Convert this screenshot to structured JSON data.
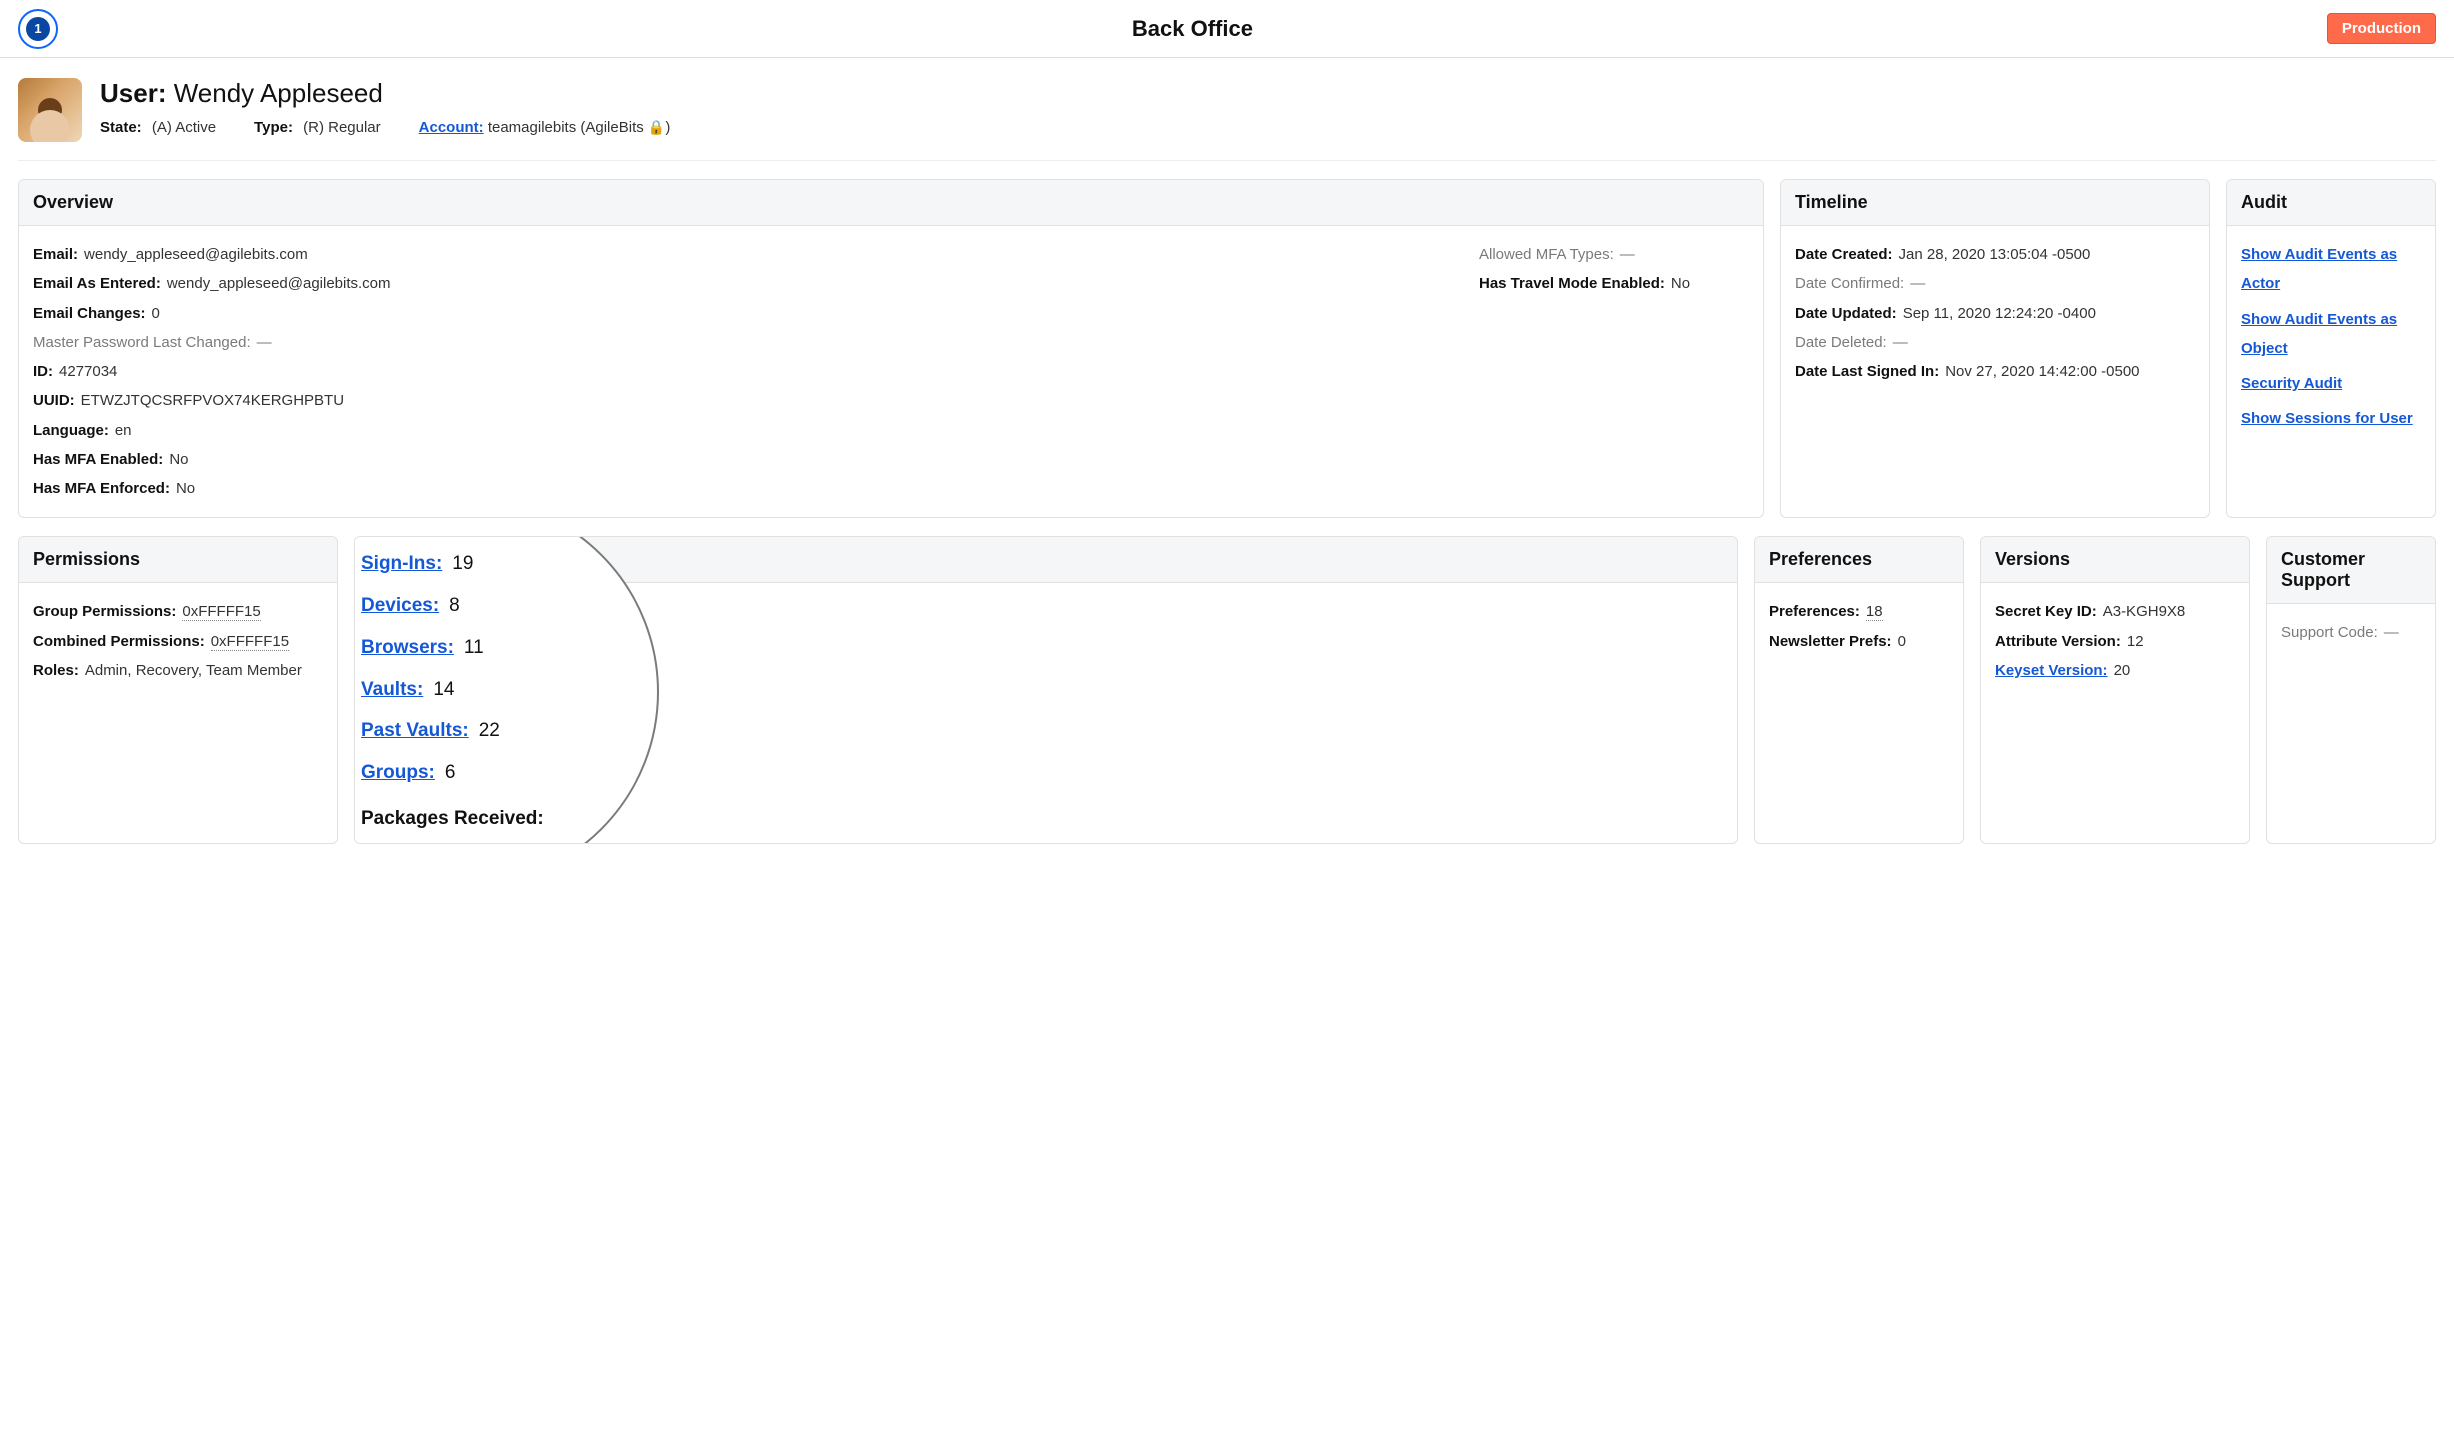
{
  "topbar": {
    "title": "Back Office",
    "env_badge": "Production",
    "logo_text": "1"
  },
  "user_header": {
    "prefix": "User:",
    "name": "Wendy Appleseed",
    "state_label": "State:",
    "state_value": "(A) Active",
    "type_label": "Type:",
    "type_value": "(R) Regular",
    "account_label": "Account:",
    "account_value": "teamagilebits (AgileBits ",
    "account_suffix": ")"
  },
  "overview": {
    "title": "Overview",
    "left": {
      "email_k": "Email:",
      "email_v": "wendy_appleseed@agilebits.com",
      "email_entered_k": "Email As Entered:",
      "email_entered_v": "wendy_appleseed@agilebits.com",
      "email_changes_k": "Email Changes:",
      "email_changes_v": "0",
      "mp_changed_k": "Master Password Last Changed:",
      "mp_changed_v": "—",
      "id_k": "ID:",
      "id_v": "4277034",
      "uuid_k": "UUID:",
      "uuid_v": "ETWZJTQCSRFPVOX74KERGHPBTU",
      "lang_k": "Language:",
      "lang_v": "en",
      "mfa_enabled_k": "Has MFA Enabled:",
      "mfa_enabled_v": "No",
      "mfa_enforced_k": "Has MFA Enforced:",
      "mfa_enforced_v": "No"
    },
    "right": {
      "mfa_types_k": "Allowed MFA Types:",
      "mfa_types_v": "—",
      "travel_k": "Has Travel Mode Enabled:",
      "travel_v": "No"
    }
  },
  "timeline": {
    "title": "Timeline",
    "created_k": "Date Created:",
    "created_v": "Jan 28, 2020 13:05:04 -0500",
    "confirmed_k": "Date Confirmed:",
    "confirmed_v": "—",
    "updated_k": "Date Updated:",
    "updated_v": "Sep 11, 2020 12:24:20 -0400",
    "deleted_k": "Date Deleted:",
    "deleted_v": "—",
    "last_signin_k": "Date Last Signed In:",
    "last_signin_v": "Nov 27, 2020 14:42:00 -0500"
  },
  "audit": {
    "title": "Audit",
    "l1": "Show Audit Events as Actor",
    "l2": "Show Audit Events as Object",
    "l3": "Security Audit",
    "l4": "Show Sessions for User"
  },
  "permissions": {
    "title": "Permissions",
    "group_k": "Group Permissions:",
    "group_v": "0xFFFFF15",
    "combined_k": "Combined Permissions:",
    "combined_v": "0xFFFFF15",
    "roles_k": "Roles:",
    "roles_v": "Admin, Recovery, Team Member"
  },
  "zoomed": {
    "title": "",
    "signins_k": "Sign-Ins:",
    "signins_v": "19",
    "devices_k": "Devices:",
    "devices_v": "8",
    "browsers_k": "Browsers:",
    "browsers_v": "11",
    "vaults_k": "Vaults:",
    "vaults_v": "14",
    "past_vaults_k": "Past Vaults:",
    "past_vaults_v": "22",
    "groups_k": "Groups:",
    "groups_v": "6",
    "packages_k": "Packages Received:"
  },
  "preferences": {
    "title": "Preferences",
    "prefs_k": "Preferences:",
    "prefs_v": "18",
    "news_k": "Newsletter Prefs:",
    "news_v": "0"
  },
  "versions": {
    "title": "Versions",
    "secret_k": "Secret Key ID:",
    "secret_v": "A3-KGH9X8",
    "attr_k": "Attribute Version:",
    "attr_v": "12",
    "keyset_k": "Keyset Version:",
    "keyset_v": "20"
  },
  "support": {
    "title": "Customer Support",
    "code_k": "Support Code:",
    "code_v": "—"
  }
}
